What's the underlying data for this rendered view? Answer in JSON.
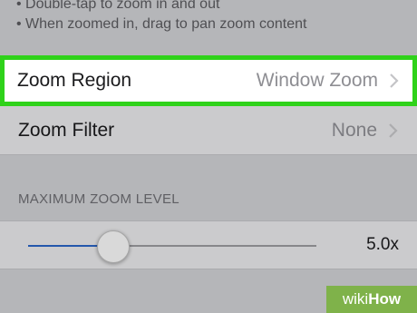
{
  "help_text": [
    "• Double-tap to zoom in and out",
    "• When zoomed in, drag to pan zoom content"
  ],
  "rows": {
    "zoom_region": {
      "label": "Zoom Region",
      "value": "Window Zoom"
    },
    "zoom_filter": {
      "label": "Zoom Filter",
      "value": "None"
    }
  },
  "section_header": "MAXIMUM ZOOM LEVEL",
  "slider": {
    "value_label": "5.0x",
    "level_fraction": 0.26
  },
  "icons": {
    "chevron": "chevron-right-icon"
  },
  "colors": {
    "highlight": "#2fd21a",
    "slider_fill": "#2a63c4",
    "watermark_bg": "#7fb24a"
  },
  "watermark": {
    "part1": "wiki",
    "part2": "How"
  }
}
